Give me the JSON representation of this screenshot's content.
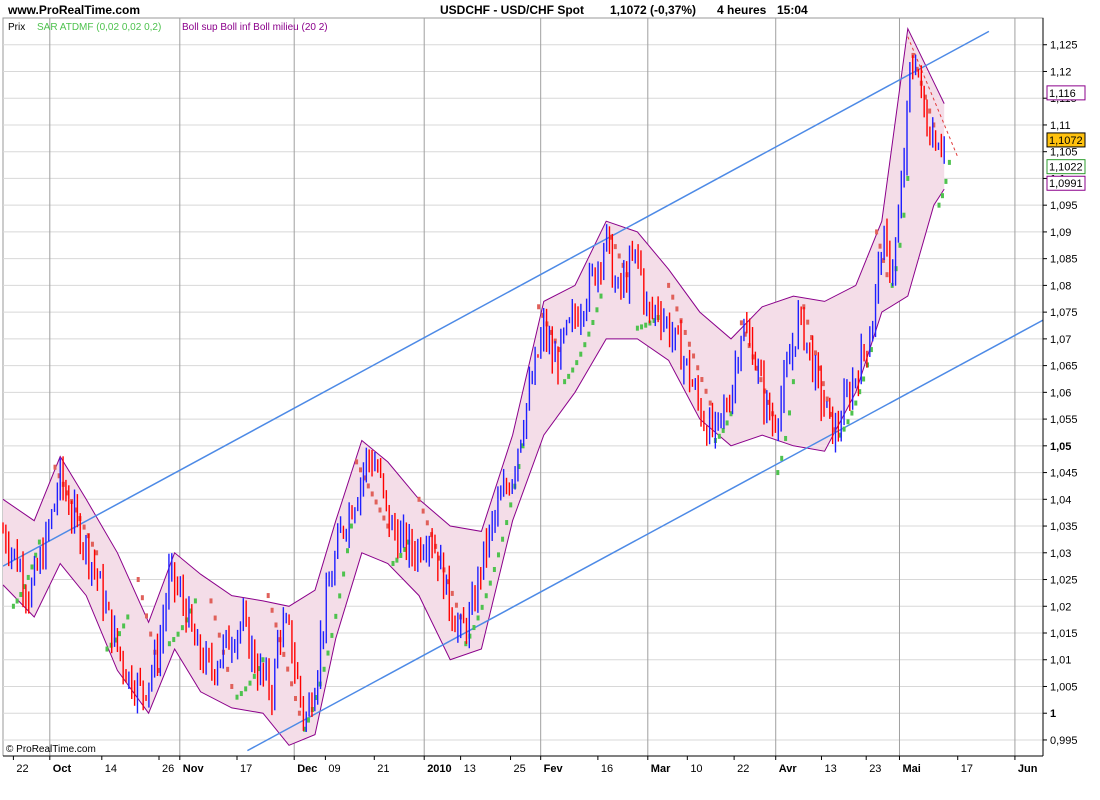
{
  "header": {
    "site": "www.ProRealTime.com",
    "instrument": "USDCHF - USD/CHF Spot",
    "last": "1,1072 (-0,37%)",
    "period": "4 heures",
    "time": "15:04"
  },
  "legend": {
    "price": "Prix",
    "sar": "SAR ATDMF (0,02 0,02 0,2)",
    "boll": "Boll sup Boll inf Boll milieu (20 2)"
  },
  "copyright": "© ProRealTime.com",
  "colors": {
    "background": "#ffffff",
    "up_candle": "#1f1fff",
    "down_candle": "#ff0000",
    "sar_up": "#4ec24e",
    "sar_down": "#e0605a",
    "bollinger_band": "#8b008b",
    "bollinger_fill": "#f4dde8",
    "channel": "#4d8ae6",
    "price_badge": "#ffc20e"
  },
  "chart_data": {
    "type": "line",
    "title": "USDCHF - USD/CHF Spot",
    "ylim": [
      0.992,
      1.13
    ],
    "y_ticks": [
      {
        "value": 0.995,
        "label": "0,995"
      },
      {
        "value": 1.0,
        "label": "1",
        "bold": true
      },
      {
        "value": 1.005,
        "label": "1,005"
      },
      {
        "value": 1.01,
        "label": "1,01"
      },
      {
        "value": 1.015,
        "label": "1,015"
      },
      {
        "value": 1.02,
        "label": "1,02"
      },
      {
        "value": 1.025,
        "label": "1,025"
      },
      {
        "value": 1.03,
        "label": "1,03"
      },
      {
        "value": 1.035,
        "label": "1,035"
      },
      {
        "value": 1.04,
        "label": "1,04"
      },
      {
        "value": 1.045,
        "label": "1,045"
      },
      {
        "value": 1.05,
        "label": "1,05",
        "bold": true
      },
      {
        "value": 1.055,
        "label": "1,055"
      },
      {
        "value": 1.06,
        "label": "1,06"
      },
      {
        "value": 1.065,
        "label": "1,065"
      },
      {
        "value": 1.07,
        "label": "1,07"
      },
      {
        "value": 1.075,
        "label": "1,075"
      },
      {
        "value": 1.08,
        "label": "1,08"
      },
      {
        "value": 1.085,
        "label": "1,085"
      },
      {
        "value": 1.09,
        "label": "1,09"
      },
      {
        "value": 1.095,
        "label": "1,095"
      },
      {
        "value": 1.1,
        "label": "1,1",
        "bold": true
      },
      {
        "value": 1.105,
        "label": "1,105"
      },
      {
        "value": 1.11,
        "label": "1,11"
      },
      {
        "value": 1.115,
        "label": "1,115"
      },
      {
        "value": 1.12,
        "label": "1,12"
      },
      {
        "value": 1.125,
        "label": "1,125"
      }
    ],
    "x_ticks": [
      {
        "label": "22",
        "t": 0.01
      },
      {
        "label": "Oct",
        "t": 0.045,
        "bold": true
      },
      {
        "label": "14",
        "t": 0.095
      },
      {
        "label": "26",
        "t": 0.15
      },
      {
        "label": "Nov",
        "t": 0.17,
        "bold": true
      },
      {
        "label": "17",
        "t": 0.225
      },
      {
        "label": "Dec",
        "t": 0.28,
        "bold": true
      },
      {
        "label": "09",
        "t": 0.31
      },
      {
        "label": "21",
        "t": 0.357
      },
      {
        "label": "2010",
        "t": 0.405,
        "bold": true
      },
      {
        "label": "13",
        "t": 0.44
      },
      {
        "label": "25",
        "t": 0.488
      },
      {
        "label": "Fev",
        "t": 0.517,
        "bold": true
      },
      {
        "label": "16",
        "t": 0.572
      },
      {
        "label": "Mar",
        "t": 0.62,
        "bold": true
      },
      {
        "label": "10",
        "t": 0.658
      },
      {
        "label": "22",
        "t": 0.703
      },
      {
        "label": "Avr",
        "t": 0.743,
        "bold": true
      },
      {
        "label": "13",
        "t": 0.787
      },
      {
        "label": "23",
        "t": 0.83
      },
      {
        "label": "Mai",
        "t": 0.862,
        "bold": true
      },
      {
        "label": "17",
        "t": 0.918
      },
      {
        "label": "Jun",
        "t": 0.973,
        "bold": true
      }
    ],
    "vgrid": [
      0.045,
      0.17,
      0.28,
      0.405,
      0.517,
      0.62,
      0.743,
      0.862,
      0.973
    ],
    "channel_lines": [
      {
        "t0": 0.0,
        "v0": 1.0275,
        "t1": 0.948,
        "v1": 1.1275
      },
      {
        "t0": 0.235,
        "v0": 0.993,
        "t1": 1.0,
        "v1": 1.0735
      }
    ],
    "trendline": {
      "t0": 0.87,
      "v0": 1.1265,
      "t1": 0.918,
      "v1": 1.104
    },
    "price_path": [
      [
        0.0,
        1.034
      ],
      [
        0.015,
        1.028
      ],
      [
        0.025,
        1.022
      ],
      [
        0.04,
        1.031
      ],
      [
        0.055,
        1.044
      ],
      [
        0.065,
        1.038
      ],
      [
        0.08,
        1.031
      ],
      [
        0.09,
        1.026
      ],
      [
        0.105,
        1.015
      ],
      [
        0.12,
        1.007
      ],
      [
        0.135,
        1.004
      ],
      [
        0.15,
        1.012
      ],
      [
        0.16,
        1.026
      ],
      [
        0.175,
        1.02
      ],
      [
        0.185,
        1.012
      ],
      [
        0.2,
        1.008
      ],
      [
        0.215,
        1.013
      ],
      [
        0.23,
        1.017
      ],
      [
        0.245,
        1.008
      ],
      [
        0.26,
        1.004
      ],
      [
        0.265,
        1.016
      ],
      [
        0.275,
        1.015
      ],
      [
        0.285,
        1.004
      ],
      [
        0.29,
        0.998
      ],
      [
        0.3,
        1.006
      ],
      [
        0.31,
        1.02
      ],
      [
        0.325,
        1.034
      ],
      [
        0.34,
        1.041
      ],
      [
        0.35,
        1.048
      ],
      [
        0.36,
        1.046
      ],
      [
        0.37,
        1.036
      ],
      [
        0.38,
        1.033
      ],
      [
        0.395,
        1.03
      ],
      [
        0.41,
        1.034
      ],
      [
        0.42,
        1.028
      ],
      [
        0.43,
        1.02
      ],
      [
        0.44,
        1.015
      ],
      [
        0.45,
        1.018
      ],
      [
        0.46,
        1.028
      ],
      [
        0.475,
        1.038
      ],
      [
        0.49,
        1.045
      ],
      [
        0.5,
        1.055
      ],
      [
        0.51,
        1.063
      ],
      [
        0.52,
        1.072
      ],
      [
        0.53,
        1.065
      ],
      [
        0.54,
        1.07
      ],
      [
        0.555,
        1.076
      ],
      [
        0.57,
        1.083
      ],
      [
        0.58,
        1.089
      ],
      [
        0.59,
        1.078
      ],
      [
        0.6,
        1.082
      ],
      [
        0.61,
        1.086
      ],
      [
        0.62,
        1.074
      ],
      [
        0.63,
        1.076
      ],
      [
        0.64,
        1.072
      ],
      [
        0.655,
        1.066
      ],
      [
        0.665,
        1.06
      ],
      [
        0.675,
        1.054
      ],
      [
        0.685,
        1.052
      ],
      [
        0.7,
        1.06
      ],
      [
        0.71,
        1.072
      ],
      [
        0.72,
        1.069
      ],
      [
        0.73,
        1.06
      ],
      [
        0.74,
        1.054
      ],
      [
        0.75,
        1.06
      ],
      [
        0.765,
        1.074
      ],
      [
        0.775,
        1.068
      ],
      [
        0.785,
        1.06
      ],
      [
        0.8,
        1.052
      ],
      [
        0.81,
        1.058
      ],
      [
        0.825,
        1.066
      ],
      [
        0.835,
        1.072
      ],
      [
        0.845,
        1.088
      ],
      [
        0.855,
        1.083
      ],
      [
        0.86,
        1.09
      ],
      [
        0.865,
        1.1
      ],
      [
        0.872,
        1.119
      ],
      [
        0.878,
        1.123
      ],
      [
        0.885,
        1.112
      ],
      [
        0.895,
        1.108
      ],
      [
        0.905,
        1.1072
      ]
    ],
    "band_upper": [
      [
        0.0,
        1.04
      ],
      [
        0.03,
        1.036
      ],
      [
        0.055,
        1.048
      ],
      [
        0.08,
        1.04
      ],
      [
        0.11,
        1.03
      ],
      [
        0.14,
        1.017
      ],
      [
        0.165,
        1.03
      ],
      [
        0.19,
        1.026
      ],
      [
        0.22,
        1.022
      ],
      [
        0.25,
        1.021
      ],
      [
        0.275,
        1.02
      ],
      [
        0.3,
        1.023
      ],
      [
        0.32,
        1.036
      ],
      [
        0.345,
        1.051
      ],
      [
        0.37,
        1.047
      ],
      [
        0.4,
        1.04
      ],
      [
        0.43,
        1.035
      ],
      [
        0.46,
        1.034
      ],
      [
        0.49,
        1.052
      ],
      [
        0.52,
        1.077
      ],
      [
        0.55,
        1.08
      ],
      [
        0.58,
        1.092
      ],
      [
        0.61,
        1.09
      ],
      [
        0.64,
        1.083
      ],
      [
        0.67,
        1.075
      ],
      [
        0.7,
        1.07
      ],
      [
        0.73,
        1.076
      ],
      [
        0.76,
        1.078
      ],
      [
        0.79,
        1.077
      ],
      [
        0.82,
        1.08
      ],
      [
        0.845,
        1.092
      ],
      [
        0.87,
        1.128
      ],
      [
        0.895,
        1.118
      ],
      [
        0.905,
        1.114
      ]
    ],
    "band_lower": [
      [
        0.0,
        1.024
      ],
      [
        0.03,
        1.018
      ],
      [
        0.055,
        1.028
      ],
      [
        0.08,
        1.022
      ],
      [
        0.11,
        1.008
      ],
      [
        0.14,
        1.0
      ],
      [
        0.165,
        1.012
      ],
      [
        0.19,
        1.004
      ],
      [
        0.22,
        1.001
      ],
      [
        0.25,
        1.0
      ],
      [
        0.275,
        0.994
      ],
      [
        0.3,
        0.996
      ],
      [
        0.32,
        1.014
      ],
      [
        0.345,
        1.03
      ],
      [
        0.37,
        1.028
      ],
      [
        0.4,
        1.022
      ],
      [
        0.43,
        1.01
      ],
      [
        0.46,
        1.012
      ],
      [
        0.49,
        1.036
      ],
      [
        0.52,
        1.052
      ],
      [
        0.55,
        1.06
      ],
      [
        0.58,
        1.07
      ],
      [
        0.61,
        1.07
      ],
      [
        0.64,
        1.066
      ],
      [
        0.67,
        1.055
      ],
      [
        0.7,
        1.05
      ],
      [
        0.73,
        1.052
      ],
      [
        0.76,
        1.05
      ],
      [
        0.79,
        1.049
      ],
      [
        0.82,
        1.06
      ],
      [
        0.845,
        1.075
      ],
      [
        0.87,
        1.078
      ],
      [
        0.895,
        1.095
      ],
      [
        0.905,
        1.098
      ]
    ],
    "sar_segments": [
      {
        "trend": "up",
        "pts": [
          [
            0.01,
            1.02
          ],
          [
            0.035,
            1.032
          ]
        ]
      },
      {
        "trend": "down",
        "pts": [
          [
            0.05,
            1.046
          ],
          [
            0.09,
            1.03
          ]
        ]
      },
      {
        "trend": "up",
        "pts": [
          [
            0.1,
            1.012
          ],
          [
            0.12,
            1.018
          ]
        ]
      },
      {
        "trend": "down",
        "pts": [
          [
            0.13,
            1.025
          ],
          [
            0.15,
            1.008
          ]
        ]
      },
      {
        "trend": "up",
        "pts": [
          [
            0.16,
            1.013
          ],
          [
            0.185,
            1.021
          ]
        ]
      },
      {
        "trend": "down",
        "pts": [
          [
            0.2,
            1.021
          ],
          [
            0.22,
            1.005
          ]
        ]
      },
      {
        "trend": "up",
        "pts": [
          [
            0.225,
            1.003
          ],
          [
            0.25,
            1.01
          ]
        ]
      },
      {
        "trend": "down",
        "pts": [
          [
            0.255,
            1.022
          ],
          [
            0.285,
            1.0
          ]
        ]
      },
      {
        "trend": "up",
        "pts": [
          [
            0.29,
            0.997
          ],
          [
            0.335,
            1.035
          ]
        ]
      },
      {
        "trend": "down",
        "pts": [
          [
            0.34,
            1.047
          ],
          [
            0.37,
            1.035
          ]
        ]
      },
      {
        "trend": "up",
        "pts": [
          [
            0.375,
            1.028
          ],
          [
            0.39,
            1.032
          ]
        ]
      },
      {
        "trend": "down",
        "pts": [
          [
            0.4,
            1.04
          ],
          [
            0.44,
            1.018
          ]
        ]
      },
      {
        "trend": "up",
        "pts": [
          [
            0.445,
            1.013
          ],
          [
            0.5,
            1.05
          ]
        ]
      },
      {
        "trend": "down",
        "pts": [
          [
            0.515,
            1.076
          ],
          [
            0.535,
            1.068
          ]
        ]
      },
      {
        "trend": "up",
        "pts": [
          [
            0.54,
            1.062
          ],
          [
            0.575,
            1.078
          ]
        ]
      },
      {
        "trend": "down",
        "pts": [
          [
            0.585,
            1.089
          ],
          [
            0.6,
            1.082
          ]
        ]
      },
      {
        "trend": "up",
        "pts": [
          [
            0.61,
            1.072
          ],
          [
            0.63,
            1.074
          ]
        ]
      },
      {
        "trend": "down",
        "pts": [
          [
            0.64,
            1.08
          ],
          [
            0.68,
            1.058
          ]
        ]
      },
      {
        "trend": "up",
        "pts": [
          [
            0.685,
            1.051
          ],
          [
            0.7,
            1.056
          ]
        ]
      },
      {
        "trend": "down",
        "pts": [
          [
            0.71,
            1.073
          ],
          [
            0.74,
            1.056
          ]
        ]
      },
      {
        "trend": "up",
        "pts": [
          [
            0.745,
            1.045
          ],
          [
            0.76,
            1.062
          ]
        ]
      },
      {
        "trend": "down",
        "pts": [
          [
            0.77,
            1.076
          ],
          [
            0.8,
            1.053
          ]
        ]
      },
      {
        "trend": "up",
        "pts": [
          [
            0.805,
            1.052
          ],
          [
            0.835,
            1.068
          ]
        ]
      },
      {
        "trend": "down",
        "pts": [
          [
            0.84,
            1.09
          ],
          [
            0.85,
            1.082
          ]
        ]
      },
      {
        "trend": "up",
        "pts": [
          [
            0.855,
            1.08
          ],
          [
            0.87,
            1.1
          ]
        ]
      },
      {
        "trend": "down",
        "pts": [
          [
            0.875,
            1.123
          ],
          [
            0.895,
            1.11
          ]
        ]
      },
      {
        "trend": "up",
        "pts": [
          [
            0.9,
            1.095
          ],
          [
            0.91,
            1.103
          ]
        ]
      }
    ],
    "price_labels": [
      {
        "value": 1.116,
        "label": "1,116",
        "style": "outline",
        "color": "#8b008b"
      },
      {
        "value": 1.1072,
        "label": "1,1072",
        "style": "filled",
        "color": "#ffc20e"
      },
      {
        "value": 1.1022,
        "label": "1,1022",
        "style": "outline",
        "color": "#2e9e2e"
      },
      {
        "value": 1.0991,
        "label": "1,0991",
        "style": "outline",
        "color": "#8b008b"
      }
    ]
  }
}
